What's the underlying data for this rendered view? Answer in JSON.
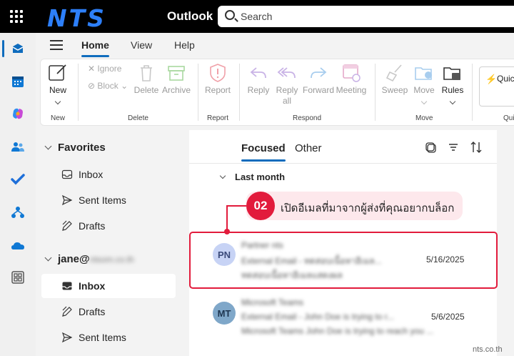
{
  "topbar": {
    "logo": "NTS",
    "app_name": "Outlook",
    "search_placeholder": "Search"
  },
  "rail": {
    "items": [
      "mail",
      "calendar",
      "copilot",
      "people",
      "to-do",
      "org-explorer",
      "onedrive",
      "apps"
    ]
  },
  "ribbon": {
    "tabs": [
      "Home",
      "View",
      "Help"
    ],
    "active_tab": "Home",
    "new": "New",
    "ignore": "Ignore",
    "block": "Block",
    "delete": "Delete",
    "archive": "Archive",
    "report": "Report",
    "reply": "Reply",
    "reply_all_1": "Reply",
    "reply_all_2": "all",
    "forward": "Forward",
    "meeting": "Meeting",
    "sweep": "Sweep",
    "move": "Move",
    "rules": "Rules",
    "quick": "Quic",
    "groups": {
      "new": "New",
      "delete": "Delete",
      "report": "Report",
      "respond": "Respond",
      "move": "Move",
      "quick": "Qui"
    }
  },
  "folders": {
    "favorites_title": "Favorites",
    "favorites": [
      "Inbox",
      "Sent Items",
      "Drafts"
    ],
    "account_prefix": "jane@",
    "account_domain": "ntsom.co.th",
    "account_folders": [
      "Inbox",
      "Drafts",
      "Sent Items"
    ],
    "selected": "Inbox"
  },
  "list": {
    "tabs": [
      "Focused",
      "Other"
    ],
    "active_tab": "Focused",
    "group": "Last month",
    "messages": [
      {
        "initials": "PN",
        "sender": "Partner nts",
        "subject": "External Email - ทดสอบเนื้อหาอีเมล...",
        "preview": "ทดสอบเนื้อหาอีเมลแสดงผล",
        "date": "5/16/2025",
        "avatar_bg": "#c7d3f5",
        "avatar_fg": "#3a4a7a"
      },
      {
        "initials": "MT",
        "sender": "Microsoft Teams",
        "subject": "External Email - John Doe is trying to r...",
        "preview": "Microsoft Teams John Doe is trying to reach you ...",
        "date": "5/6/2025",
        "avatar_bg": "#7fa7c9",
        "avatar_fg": "#1d3550"
      }
    ]
  },
  "callout": {
    "number": "02",
    "text": "เปิดอีเมลที่มาจากผู้ส่งที่คุณอยากบล็อก",
    "color": "#e21b3c"
  },
  "watermark": "nts.co.th"
}
